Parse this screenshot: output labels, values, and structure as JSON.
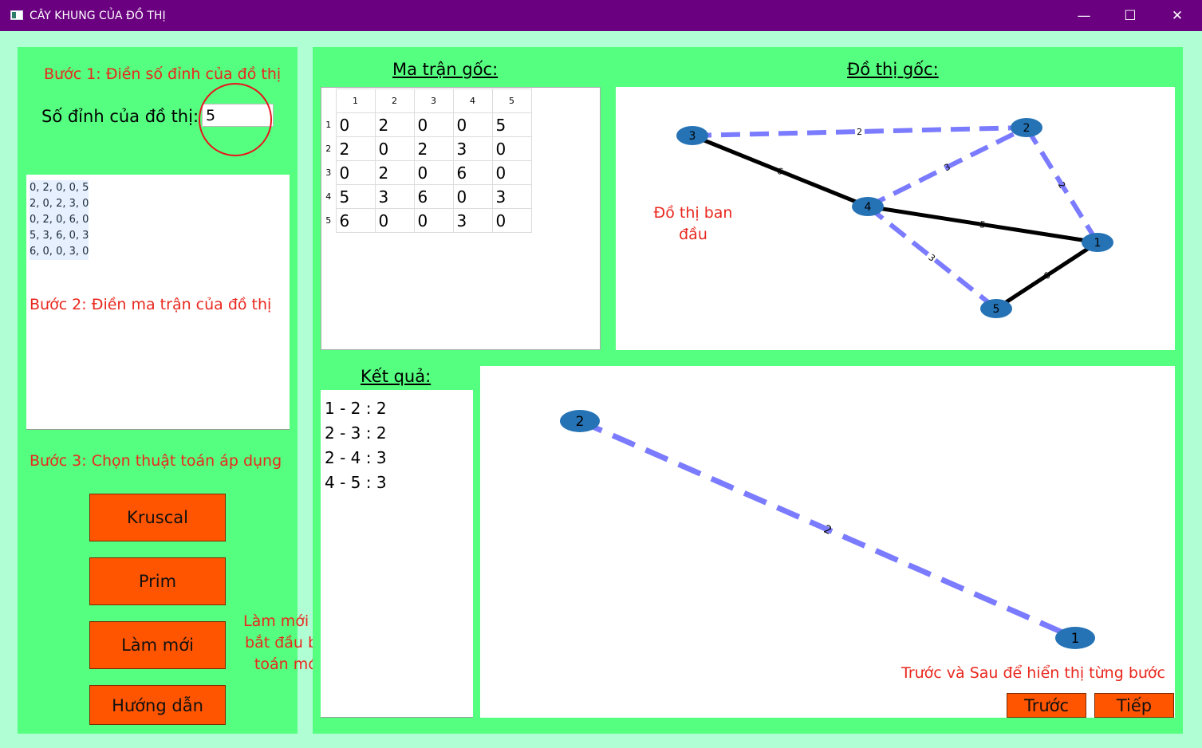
{
  "window": {
    "title": "CÂY KHUNG CỦA ĐỒ THỊ",
    "minimize": "—",
    "maximize": "☐",
    "close": "✕"
  },
  "left": {
    "step1": "Bước 1: Điền số đỉnh của đồ thị",
    "vertex_label": "Số đỉnh của đồ thị:",
    "vertex_value": "5",
    "matrix_input_lines": [
      "0, 2, 0, 0, 5",
      "2, 0, 2, 3, 0",
      "0, 2, 0, 6, 0",
      "5, 3, 6, 0, 3",
      "6, 0, 0, 3, 0"
    ],
    "step2": "Bước 2: Điền ma trận của đồ thị",
    "step3": "Bước 3: Chọn thuật toán áp dụng",
    "buttons": {
      "kruscal": "Kruscal",
      "prim": "Prim",
      "reset": "Làm mới",
      "help": "Hướng dẫn"
    },
    "reset_note": [
      "Làm mới để",
      "bắt đầu bài",
      "toán mới"
    ]
  },
  "matrix": {
    "heading": "Ma trận gốc:",
    "col_headers": [
      "1",
      "2",
      "3",
      "4",
      "5"
    ],
    "row_headers": [
      "1",
      "2",
      "3",
      "4",
      "5"
    ],
    "rows": [
      [
        "0",
        "2",
        "0",
        "0",
        "5"
      ],
      [
        "2",
        "0",
        "2",
        "3",
        "0"
      ],
      [
        "0",
        "2",
        "0",
        "6",
        "0"
      ],
      [
        "5",
        "3",
        "6",
        "0",
        "3"
      ],
      [
        "6",
        "0",
        "0",
        "3",
        "0"
      ]
    ]
  },
  "graph": {
    "heading": "Đồ thị gốc:",
    "note": [
      "Đồ thị ban",
      "đầu"
    ],
    "node_color": "#2573b5",
    "mst_edge_color": "#7b7bff",
    "edge_color": "#000000",
    "nodes": [
      "1",
      "2",
      "3",
      "4",
      "5"
    ],
    "edges": [
      {
        "a": "3",
        "b": "2",
        "w": "2",
        "mst": true
      },
      {
        "a": "2",
        "b": "1",
        "w": "2",
        "mst": true
      },
      {
        "a": "4",
        "b": "2",
        "w": "3",
        "mst": true
      },
      {
        "a": "4",
        "b": "5",
        "w": "3",
        "mst": true
      },
      {
        "a": "3",
        "b": "4",
        "w": "6",
        "mst": false
      },
      {
        "a": "4",
        "b": "1",
        "w": "5",
        "mst": false
      },
      {
        "a": "5",
        "b": "1",
        "w": "6",
        "mst": false
      }
    ]
  },
  "result": {
    "heading": "Kết quả:",
    "lines": [
      "1 - 2 : 2",
      "2 - 3 : 2",
      "2 - 4 : 3",
      "4 - 5 : 3"
    ]
  },
  "step_view": {
    "nodes": [
      "2",
      "1"
    ],
    "edge_weight": "2",
    "note": "Trước và Sau để hiển thị từng bước",
    "prev": "Trước",
    "next": "Tiếp"
  }
}
